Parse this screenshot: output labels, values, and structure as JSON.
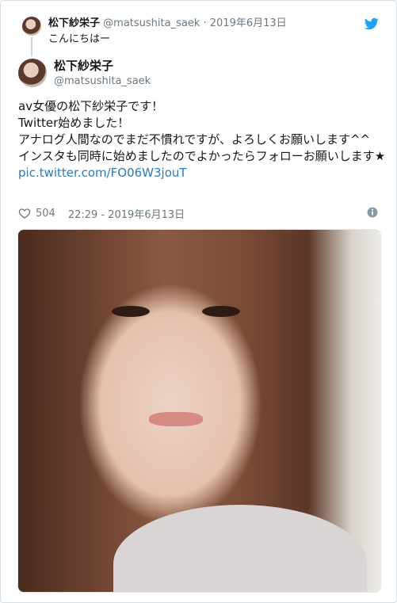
{
  "parent_tweet": {
    "display_name": "松下紗栄子",
    "handle": "@matsushita_saek",
    "separator": "·",
    "date": "2019年6月13日",
    "text": "こんにちはー"
  },
  "tweet": {
    "display_name": "松下紗栄子",
    "handle": "@matsushita_saek",
    "lines": [
      "av女優の松下紗栄子です！",
      "Twitter始めました！",
      "アナログ人間なのでまだ不慣れですが、よろしくお願いします^^",
      "インスタも同時に始めましたのでよかったらフォローお願いします★ "
    ],
    "link": "pic.twitter.com/FO06W3jouT",
    "likes": "504",
    "timestamp": "22:29 - 2019年6月13日"
  },
  "icons": {
    "brand": "twitter-bird-icon",
    "like": "heart-icon",
    "info": "info-icon"
  },
  "colors": {
    "accent": "#1da1f2",
    "link": "#2b7bb9",
    "muted": "#697882"
  }
}
